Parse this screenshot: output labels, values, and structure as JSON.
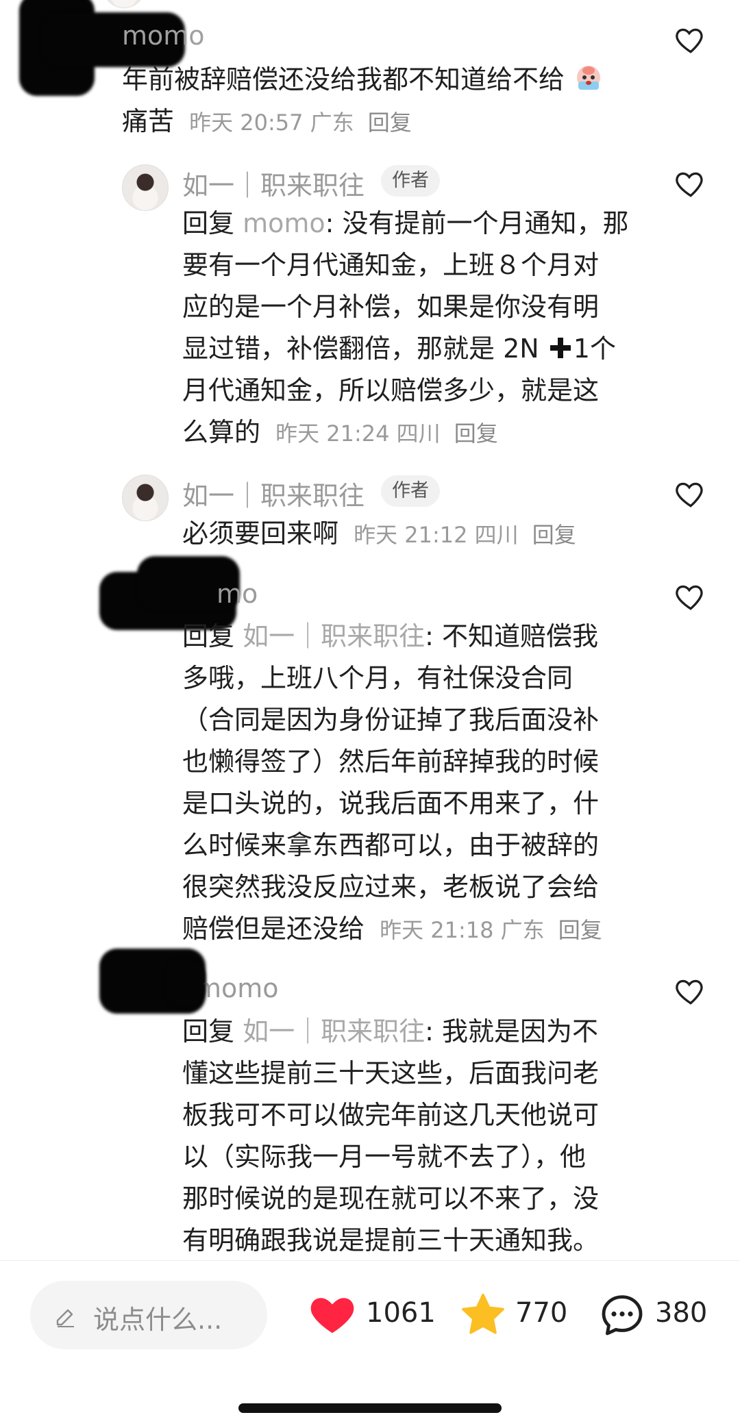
{
  "comments": [
    {
      "username": "momo",
      "text_line1": "年前被辞赔偿还没给我都不知道给不给",
      "text_line2_prefix": "痛苦",
      "meta": "昨天 20:57 广东",
      "reply_label": "回复"
    },
    {
      "username": "如一｜职来职往",
      "author_tag": "作者",
      "reply_prefix": "回复 ",
      "reply_target": "momo",
      "lines": [
        ": 没有提前一个月通知，那",
        "要有一个月代通知金，上班８个月对",
        "应的是一个月补偿，如果是你没有明",
        "显过错，补偿翻倍，那就是 2N",
        "月代通知金，所以赔偿多少，就是这",
        "么算的"
      ],
      "line4_suffix": "1个",
      "meta": "昨天 21:24 四川",
      "reply_label": "回复"
    },
    {
      "username": "如一｜职来职往",
      "author_tag": "作者",
      "text": "必须要回来啊",
      "meta": "昨天 21:12 四川",
      "reply_label": "回复"
    },
    {
      "username": "mo",
      "reply_prefix": "回复 ",
      "reply_target": "如一｜职来职往",
      "lines": [
        ": 不知道赔偿我",
        "多哦，上班八个月，有社保没合同",
        "（合同是因为身份证掉了我后面没补",
        "也懒得签了）然后年前辞掉我的时候",
        "是口头说的，说我后面不用来了，什",
        "么时候来拿东西都可以，由于被辞的",
        "很突然我没反应过来，老板说了会给",
        "赔偿但是还没给"
      ],
      "meta": "昨天 21:18 广东",
      "reply_label": "回复"
    },
    {
      "username": "momo",
      "reply_prefix": "回复 ",
      "reply_target": "如一｜职来职往",
      "lines": [
        ": 我就是因为不",
        "懂这些提前三十天这些，后面我问老",
        "板我可不可以做完年前这几天他说可",
        "以（实际我一月一号就不去了），他",
        "那时候说的是现在就可以不来了，没",
        "有明确跟我说是提前三十天通知我。"
      ]
    }
  ],
  "bottom_bar": {
    "input_placeholder": "说点什么...",
    "likes": "1061",
    "favorites": "770",
    "comments": "380"
  },
  "colors": {
    "like": "#ff2442",
    "favorite": "#fbbf24",
    "muted": "#9a9a9a"
  },
  "icons": [
    "heart-outline-icon",
    "pencil-icon",
    "heart-filled-icon",
    "star-filled-icon",
    "chat-bubble-icon",
    "crying-emoji-icon",
    "plus-emoji-icon"
  ]
}
